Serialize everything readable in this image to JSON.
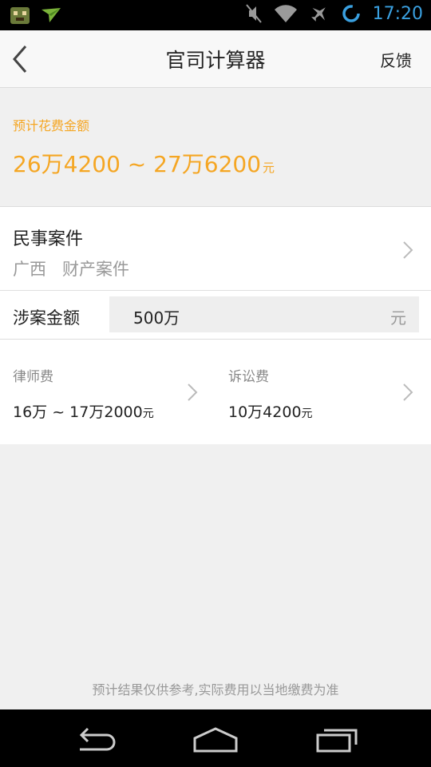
{
  "status_bar": {
    "time": "17:20",
    "icons": [
      "app-notification-icon",
      "paper-plane-icon",
      "mute-icon",
      "wifi-icon",
      "airplane-mode-icon",
      "sync-icon"
    ]
  },
  "header": {
    "title": "官司计算器",
    "feedback_label": "反馈"
  },
  "estimate": {
    "label": "预计花费金额",
    "value": "26万4200 ~ 27万6200",
    "unit": "元"
  },
  "case": {
    "type": "民事案件",
    "region": "广西",
    "category": "财产案件"
  },
  "amount": {
    "label": "涉案金额",
    "value": "500万",
    "unit": "元"
  },
  "fees": {
    "lawyer": {
      "label": "律师费",
      "value": "16万 ~ 17万2000",
      "unit": "元"
    },
    "litigation": {
      "label": "诉讼费",
      "value": "10万4200",
      "unit": "元"
    }
  },
  "footer_note": "预计结果仅供参考,实际费用以当地缴费为准",
  "colors": {
    "accent": "#f5a623",
    "status_time": "#3aa0e0"
  }
}
